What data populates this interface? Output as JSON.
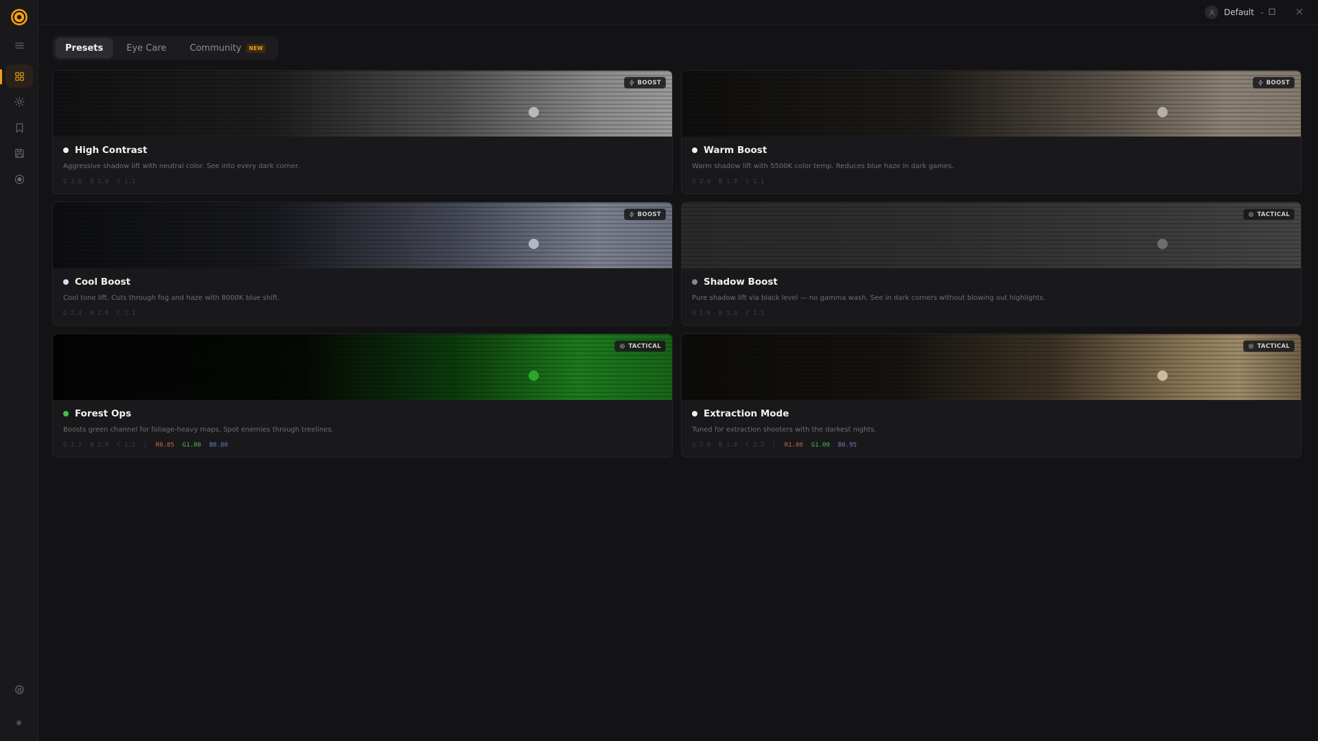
{
  "sidebar": {
    "items": [
      {
        "icon": "menu-icon"
      },
      {
        "icon": "grid-icon",
        "active": true
      },
      {
        "icon": "sun-icon"
      },
      {
        "icon": "bookmark-icon"
      },
      {
        "icon": "save-icon"
      },
      {
        "icon": "target-icon"
      },
      {
        "icon": "gear-icon"
      }
    ],
    "accent": "#f39c1b"
  },
  "titlebar": {
    "profile_name": "Default"
  },
  "tabs": [
    {
      "label": "Presets",
      "active": true
    },
    {
      "label": "Eye Care",
      "active": false
    },
    {
      "label": "Community",
      "active": false,
      "badge": "NEW"
    }
  ],
  "presets": [
    {
      "title": "High Contrast",
      "description": "Aggressive shadow lift with neutral color. See into every dark corner.",
      "badge": "BOOST",
      "params": [
        "G 2.6",
        "B 1.0",
        "C 1.1"
      ],
      "rgb": [],
      "dot_color": "#f2f2f2",
      "knob_color": "#b9b9bb"
    },
    {
      "title": "Warm Boost",
      "description": "Warm shadow lift with 5500K color temp. Reduces blue haze in dark games.",
      "badge": "BOOST",
      "params": [
        "G 2.4",
        "B 1.0",
        "C 1.1"
      ],
      "rgb": [],
      "dot_color": "#f2f2f2",
      "knob_color": "#b4b0ab"
    },
    {
      "title": "Cool Boost",
      "description": "Cool tone lift. Cuts through fog and haze with 8000K blue shift.",
      "badge": "BOOST",
      "params": [
        "G 2.4",
        "B 1.0",
        "C 1.1"
      ],
      "rgb": [],
      "dot_color": "#d9dcf2",
      "knob_color": "#b3b6c1"
    },
    {
      "title": "Shadow Boost",
      "description": "Pure shadow lift via black level — no gamma wash. See in dark corners without blowing out highlights.",
      "badge": "TACTICAL",
      "params": [
        "G 1.0",
        "B 1.8",
        "C 1.1"
      ],
      "rgb": [],
      "dot_color": "#8a8a8d",
      "knob_color": "#6e6e72"
    },
    {
      "title": "Forest Ops",
      "description": "Boosts green channel for foliage-heavy maps. Spot enemies through treelines.",
      "badge": "TACTICAL",
      "params": [
        "G 2.2",
        "B 1.0",
        "C 1.2"
      ],
      "rgb": [
        "R0.85",
        "G1.00",
        "B0.80"
      ],
      "dot_color": "#43c043",
      "knob_color": "#2aa82a"
    },
    {
      "title": "Extraction Mode",
      "description": "Tuned for extraction shooters with the darkest nights.",
      "badge": "TACTICAL",
      "params": [
        "G 2.8",
        "B 1.0",
        "C 1.2"
      ],
      "rgb": [
        "R1.00",
        "G1.00",
        "B0.95"
      ],
      "dot_color": "#f2f2f2",
      "knob_color": "#cbbb9e"
    }
  ]
}
